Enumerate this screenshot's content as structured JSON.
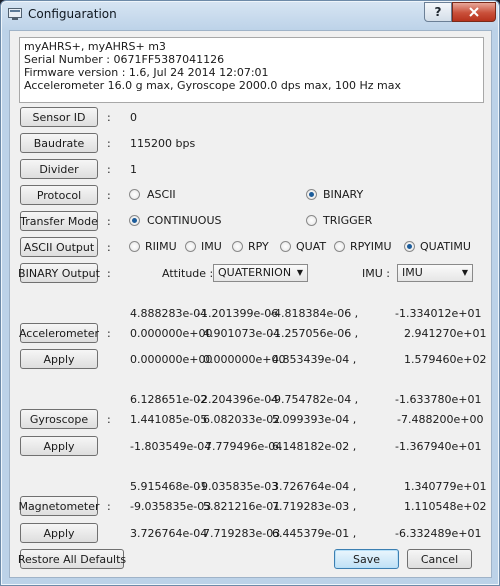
{
  "window": {
    "title": "Configuaration",
    "help_label": "?",
    "close_label": "X"
  },
  "info": {
    "lines": [
      "myAHRS+, myAHRS+ m3",
      "Serial Number : 0671FF5387041126",
      "Firmware version :  1.6, Jul 24 2014 12:07:01",
      "Accelerometer 16.0 g max, Gyroscope 2000.0 dps max, 100 Hz max"
    ]
  },
  "colon": ":",
  "sensor_id": {
    "label": "Sensor ID",
    "value": "0"
  },
  "baudrate": {
    "label": "Baudrate",
    "value": "115200 bps"
  },
  "divider": {
    "label": "Divider",
    "value": "1"
  },
  "protocol": {
    "label": "Protocol",
    "options": [
      "ASCII",
      "BINARY"
    ],
    "selected": "BINARY"
  },
  "transfer_mode": {
    "label": "Transfer Mode",
    "options": [
      "CONTINUOUS",
      "TRIGGER"
    ],
    "selected": "CONTINUOUS"
  },
  "ascii_output": {
    "label": "ASCII Output",
    "options": [
      "RIIMU",
      "IMU",
      "RPY",
      "QUAT",
      "RPYIMU",
      "QUATIMU"
    ],
    "selected": "QUATIMU"
  },
  "binary_output": {
    "label": "BINARY Output",
    "attitude_label": "Attitude :",
    "attitude_value": "QUATERNION",
    "imu_label": "IMU :",
    "imu_value": "IMU"
  },
  "accelerometer": {
    "label": "Accelerometer",
    "apply_label": "Apply",
    "rows": [
      [
        "4.888283e-04",
        "-1.201399e-06",
        "-4.818384e-06 ,",
        "-1.334012e+01"
      ],
      [
        "0.000000e+00",
        "4.901073e-04",
        "-1.257056e-06 ,",
        "2.941270e+01"
      ],
      [
        "0.000000e+00",
        "0.000000e+00",
        "4.853439e-04 ,",
        "1.579460e+02"
      ]
    ]
  },
  "gyroscope": {
    "label": "Gyroscope",
    "apply_label": "Apply",
    "rows": [
      [
        "6.128651e-02",
        "-2.204396e-04",
        "-9.754782e-04 ,",
        "-1.633780e+01"
      ],
      [
        "1.441085e-05",
        "6.082033e-02",
        "5.099393e-04 ,",
        "-7.488200e+00"
      ],
      [
        "-1.803549e-04",
        "7.779496e-04",
        "6.148182e-02 ,",
        "-1.367940e+01"
      ]
    ]
  },
  "magnetometer": {
    "label": "Magnetometer",
    "apply_label": "Apply",
    "rows": [
      [
        "5.915468e-01",
        "-9.035835e-03",
        "3.726764e-04 ,",
        "1.340779e+01"
      ],
      [
        "-9.035835e-03",
        "5.821216e-01",
        "7.719283e-03 ,",
        "1.110548e+02"
      ],
      [
        "3.726764e-04",
        "7.719283e-03",
        "6.445379e-01 ,",
        "-6.332489e+01"
      ]
    ]
  },
  "footer": {
    "restore_label": "Restore All Defaults",
    "save_label": "Save",
    "cancel_label": "Cancel"
  }
}
